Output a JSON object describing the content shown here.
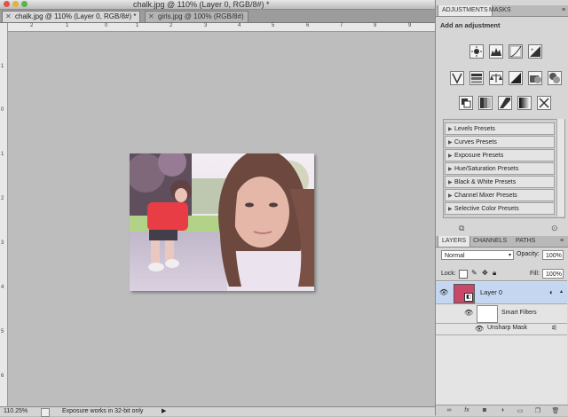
{
  "window": {
    "title": "chalk.jpg @ 110% (Layer 0, RGB/8#) *"
  },
  "tabs": [
    {
      "label": "chalk.jpg @ 110% (Layer 0, RGB/8#) *",
      "close": "✕"
    },
    {
      "label": "girls.jpg @ 100% (RGB/8#)",
      "close": "✕"
    }
  ],
  "ruler": {
    "top_numbers": [
      "2",
      "1",
      "0",
      "1",
      "2",
      "3",
      "4",
      "5",
      "6",
      "7",
      "8",
      "9"
    ],
    "left_numbers": [
      "1",
      "0",
      "1",
      "2",
      "3",
      "4",
      "5",
      "6"
    ]
  },
  "status": {
    "zoom": "110.25%",
    "message": "Exposure works in 32-bit only"
  },
  "adjustments_panel": {
    "tabs": [
      "ADJUSTMENTS",
      "MASKS"
    ],
    "heading": "Add an adjustment",
    "icon_rows": [
      [
        "brightness-contrast-icon",
        "levels-icon",
        "curves-icon",
        "exposure-icon"
      ],
      [
        "vibrance-icon",
        "hue-saturation-icon",
        "color-balance-icon",
        "black-white-icon",
        "photo-filter-icon",
        "channel-mixer-icon"
      ],
      [
        "invert-icon",
        "posterize-icon",
        "threshold-icon",
        "gradient-map-icon",
        "selective-color-icon"
      ]
    ],
    "presets": [
      "Levels Presets",
      "Curves Presets",
      "Exposure Presets",
      "Hue/Saturation Presets",
      "Black & White Presets",
      "Channel Mixer Presets",
      "Selective Color Presets"
    ]
  },
  "layers_panel": {
    "tabs": [
      "LAYERS",
      "CHANNELS",
      "PATHS"
    ],
    "blend_mode": "Normal",
    "opacity_label": "Opacity:",
    "opacity_value": "100%",
    "lock_label": "Lock:",
    "fill_label": "Fill:",
    "fill_value": "100%",
    "layers": [
      {
        "name": "Layer 0",
        "selected": true
      },
      {
        "name": "Smart Filters"
      },
      {
        "name": "Unsharp Mask"
      }
    ],
    "bottom_icons": [
      "link-icon",
      "fx-icon",
      "add-mask-icon",
      "adjustment-layer-icon",
      "group-icon",
      "new-layer-icon",
      "trash-icon"
    ]
  },
  "colors": {
    "selected_layer": "#c5d7f0",
    "panel_bg": "#d6d6d6",
    "canvas_bg": "#bdbdbd"
  }
}
